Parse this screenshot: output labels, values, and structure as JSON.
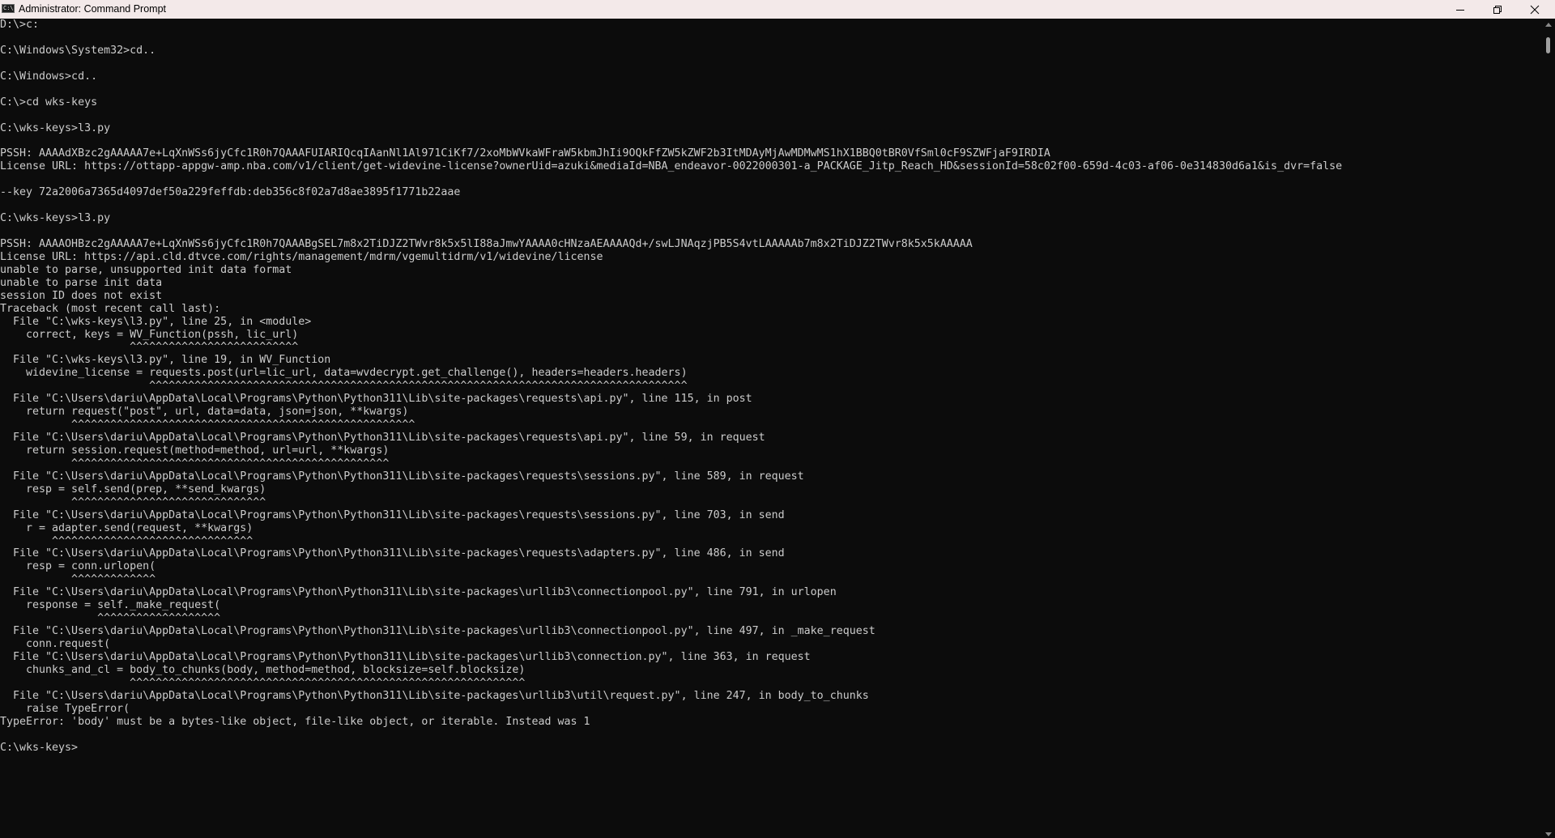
{
  "window": {
    "title": "Administrator: Command Prompt",
    "icon": "cmd-app-icon",
    "icon_glyph": "C:\\",
    "controls": {
      "minimize": "minimize-icon",
      "maximize": "restore-icon",
      "close": "close-icon"
    }
  },
  "colors": {
    "titlebar_bg": "#f3e9e9",
    "terminal_bg": "#0c0c0c",
    "terminal_text": "#cccccc"
  },
  "terminal": {
    "lines": [
      "D:\\>c:",
      "",
      "C:\\Windows\\System32>cd..",
      "",
      "C:\\Windows>cd..",
      "",
      "C:\\>cd wks-keys",
      "",
      "C:\\wks-keys>l3.py",
      "",
      "PSSH: AAAAdXBzc2gAAAAA7e+LqXnWSs6jyCfc1R0h7QAAAFUIARIQcqIAanNl1Al971CiKf7/2xoMbWVkaWFraW5kbmJhIi9OQkFfZW5kZWF2b3ItMDAyMjAwMDMwMS1hX1BBQ0tBR0VfSml0cF9SZWFjaF9IRDIA",
      "License URL: https://ottapp-appgw-amp.nba.com/v1/client/get-widevine-license?ownerUid=azuki&mediaId=NBA_endeavor-0022000301-a_PACKAGE_Jitp_Reach_HD&sessionId=58c02f00-659d-4c03-af06-0e314830d6a1&is_dvr=false",
      "",
      "--key 72a2006a7365d4097def50a229feffdb:deb356c8f02a7d8ae3895f1771b22aae",
      "",
      "C:\\wks-keys>l3.py",
      "",
      "PSSH: AAAAOHBzc2gAAAAA7e+LqXnWSs6jyCfc1R0h7QAAABgSEL7m8x2TiDJZ2TWvr8k5x5lI88aJmwYAAAA0cHNzaAEAAAAQd+/swLJNAqzjPB5S4vtLAAAAAb7m8x2TiDJZ2TWvr8k5x5kAAAAA",
      "License URL: https://api.cld.dtvce.com/rights/management/mdrm/vgemultidrm/v1/widevine/license",
      "unable to parse, unsupported init data format",
      "unable to parse init data",
      "session ID does not exist",
      "Traceback (most recent call last):",
      "  File \"C:\\wks-keys\\l3.py\", line 25, in <module>",
      "    correct, keys = WV_Function(pssh, lic_url)",
      "                    ^^^^^^^^^^^^^^^^^^^^^^^^^^",
      "  File \"C:\\wks-keys\\l3.py\", line 19, in WV_Function",
      "    widevine_license = requests.post(url=lic_url, data=wvdecrypt.get_challenge(), headers=headers.headers)",
      "                       ^^^^^^^^^^^^^^^^^^^^^^^^^^^^^^^^^^^^^^^^^^^^^^^^^^^^^^^^^^^^^^^^^^^^^^^^^^^^^^^^^^^",
      "  File \"C:\\Users\\dariu\\AppData\\Local\\Programs\\Python\\Python311\\Lib\\site-packages\\requests\\api.py\", line 115, in post",
      "    return request(\"post\", url, data=data, json=json, **kwargs)",
      "           ^^^^^^^^^^^^^^^^^^^^^^^^^^^^^^^^^^^^^^^^^^^^^^^^^^^^^",
      "  File \"C:\\Users\\dariu\\AppData\\Local\\Programs\\Python\\Python311\\Lib\\site-packages\\requests\\api.py\", line 59, in request",
      "    return session.request(method=method, url=url, **kwargs)",
      "           ^^^^^^^^^^^^^^^^^^^^^^^^^^^^^^^^^^^^^^^^^^^^^^^^^",
      "  File \"C:\\Users\\dariu\\AppData\\Local\\Programs\\Python\\Python311\\Lib\\site-packages\\requests\\sessions.py\", line 589, in request",
      "    resp = self.send(prep, **send_kwargs)",
      "           ^^^^^^^^^^^^^^^^^^^^^^^^^^^^^^",
      "  File \"C:\\Users\\dariu\\AppData\\Local\\Programs\\Python\\Python311\\Lib\\site-packages\\requests\\sessions.py\", line 703, in send",
      "    r = adapter.send(request, **kwargs)",
      "        ^^^^^^^^^^^^^^^^^^^^^^^^^^^^^^^",
      "  File \"C:\\Users\\dariu\\AppData\\Local\\Programs\\Python\\Python311\\Lib\\site-packages\\requests\\adapters.py\", line 486, in send",
      "    resp = conn.urlopen(",
      "           ^^^^^^^^^^^^^",
      "  File \"C:\\Users\\dariu\\AppData\\Local\\Programs\\Python\\Python311\\Lib\\site-packages\\urllib3\\connectionpool.py\", line 791, in urlopen",
      "    response = self._make_request(",
      "               ^^^^^^^^^^^^^^^^^^^",
      "  File \"C:\\Users\\dariu\\AppData\\Local\\Programs\\Python\\Python311\\Lib\\site-packages\\urllib3\\connectionpool.py\", line 497, in _make_request",
      "    conn.request(",
      "  File \"C:\\Users\\dariu\\AppData\\Local\\Programs\\Python\\Python311\\Lib\\site-packages\\urllib3\\connection.py\", line 363, in request",
      "    chunks_and_cl = body_to_chunks(body, method=method, blocksize=self.blocksize)",
      "                    ^^^^^^^^^^^^^^^^^^^^^^^^^^^^^^^^^^^^^^^^^^^^^^^^^^^^^^^^^^^^^",
      "  File \"C:\\Users\\dariu\\AppData\\Local\\Programs\\Python\\Python311\\Lib\\site-packages\\urllib3\\util\\request.py\", line 247, in body_to_chunks",
      "    raise TypeError(",
      "TypeError: 'body' must be a bytes-like object, file-like object, or iterable. Instead was 1",
      "",
      "C:\\wks-keys>"
    ]
  }
}
